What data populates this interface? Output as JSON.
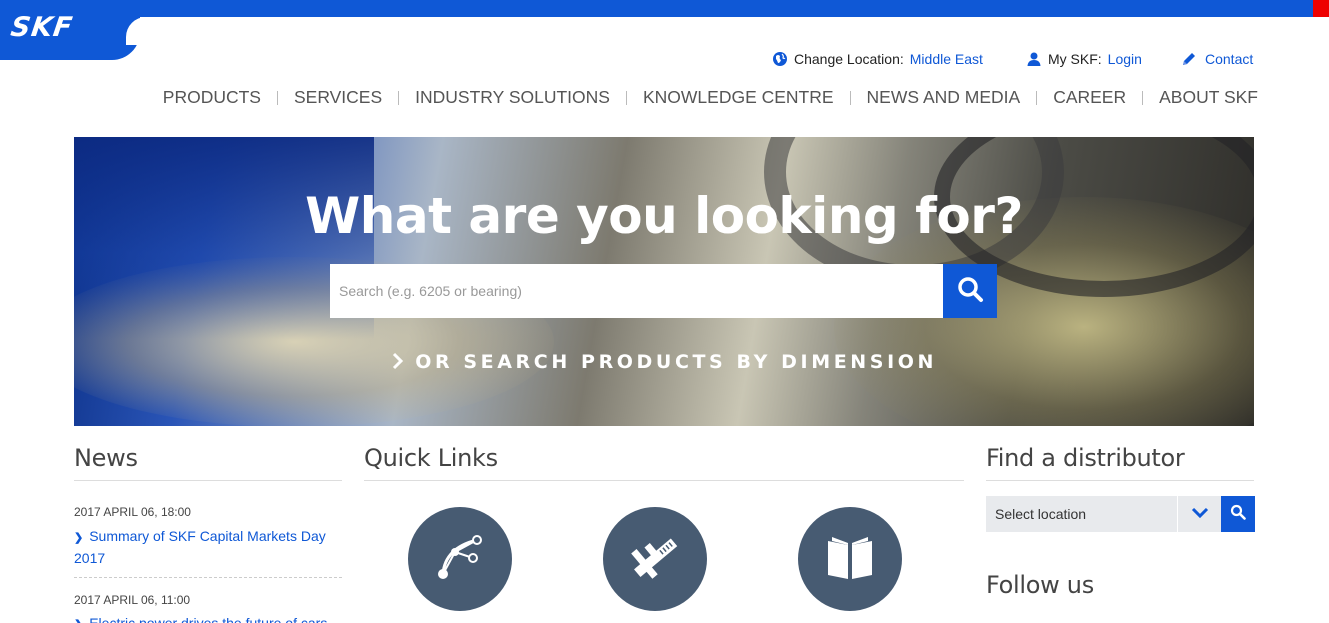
{
  "brand": {
    "logo_text": "SKF",
    "color": "#0f58d6"
  },
  "utility": {
    "location_label": "Change Location:",
    "location_value": "Middle East",
    "myskf_label": "My SKF:",
    "myskf_link": "Login",
    "contact": "Contact"
  },
  "nav": [
    "PRODUCTS",
    "SERVICES",
    "INDUSTRY SOLUTIONS",
    "KNOWLEDGE CENTRE",
    "NEWS AND MEDIA",
    "CAREER",
    "ABOUT SKF"
  ],
  "hero": {
    "title": "What are you looking for?",
    "search_placeholder": "Search (e.g. 6205 or bearing)",
    "dimension_link": "OR SEARCH PRODUCTS BY DIMENSION"
  },
  "news": {
    "title": "News",
    "items": [
      {
        "date": "2017 APRIL 06, 18:00",
        "headline": "Summary of SKF Capital Markets Day 2017"
      },
      {
        "date": "2017 APRIL 06, 11:00",
        "headline": "Electric power drives the future of cars"
      }
    ]
  },
  "quick_links": {
    "title": "Quick Links",
    "icons": [
      "bezier-curve-icon",
      "caliper-icon",
      "open-book-icon"
    ]
  },
  "distributor": {
    "title": "Find a distributor",
    "select_value": "Select location"
  },
  "follow": {
    "title": "Follow us"
  }
}
